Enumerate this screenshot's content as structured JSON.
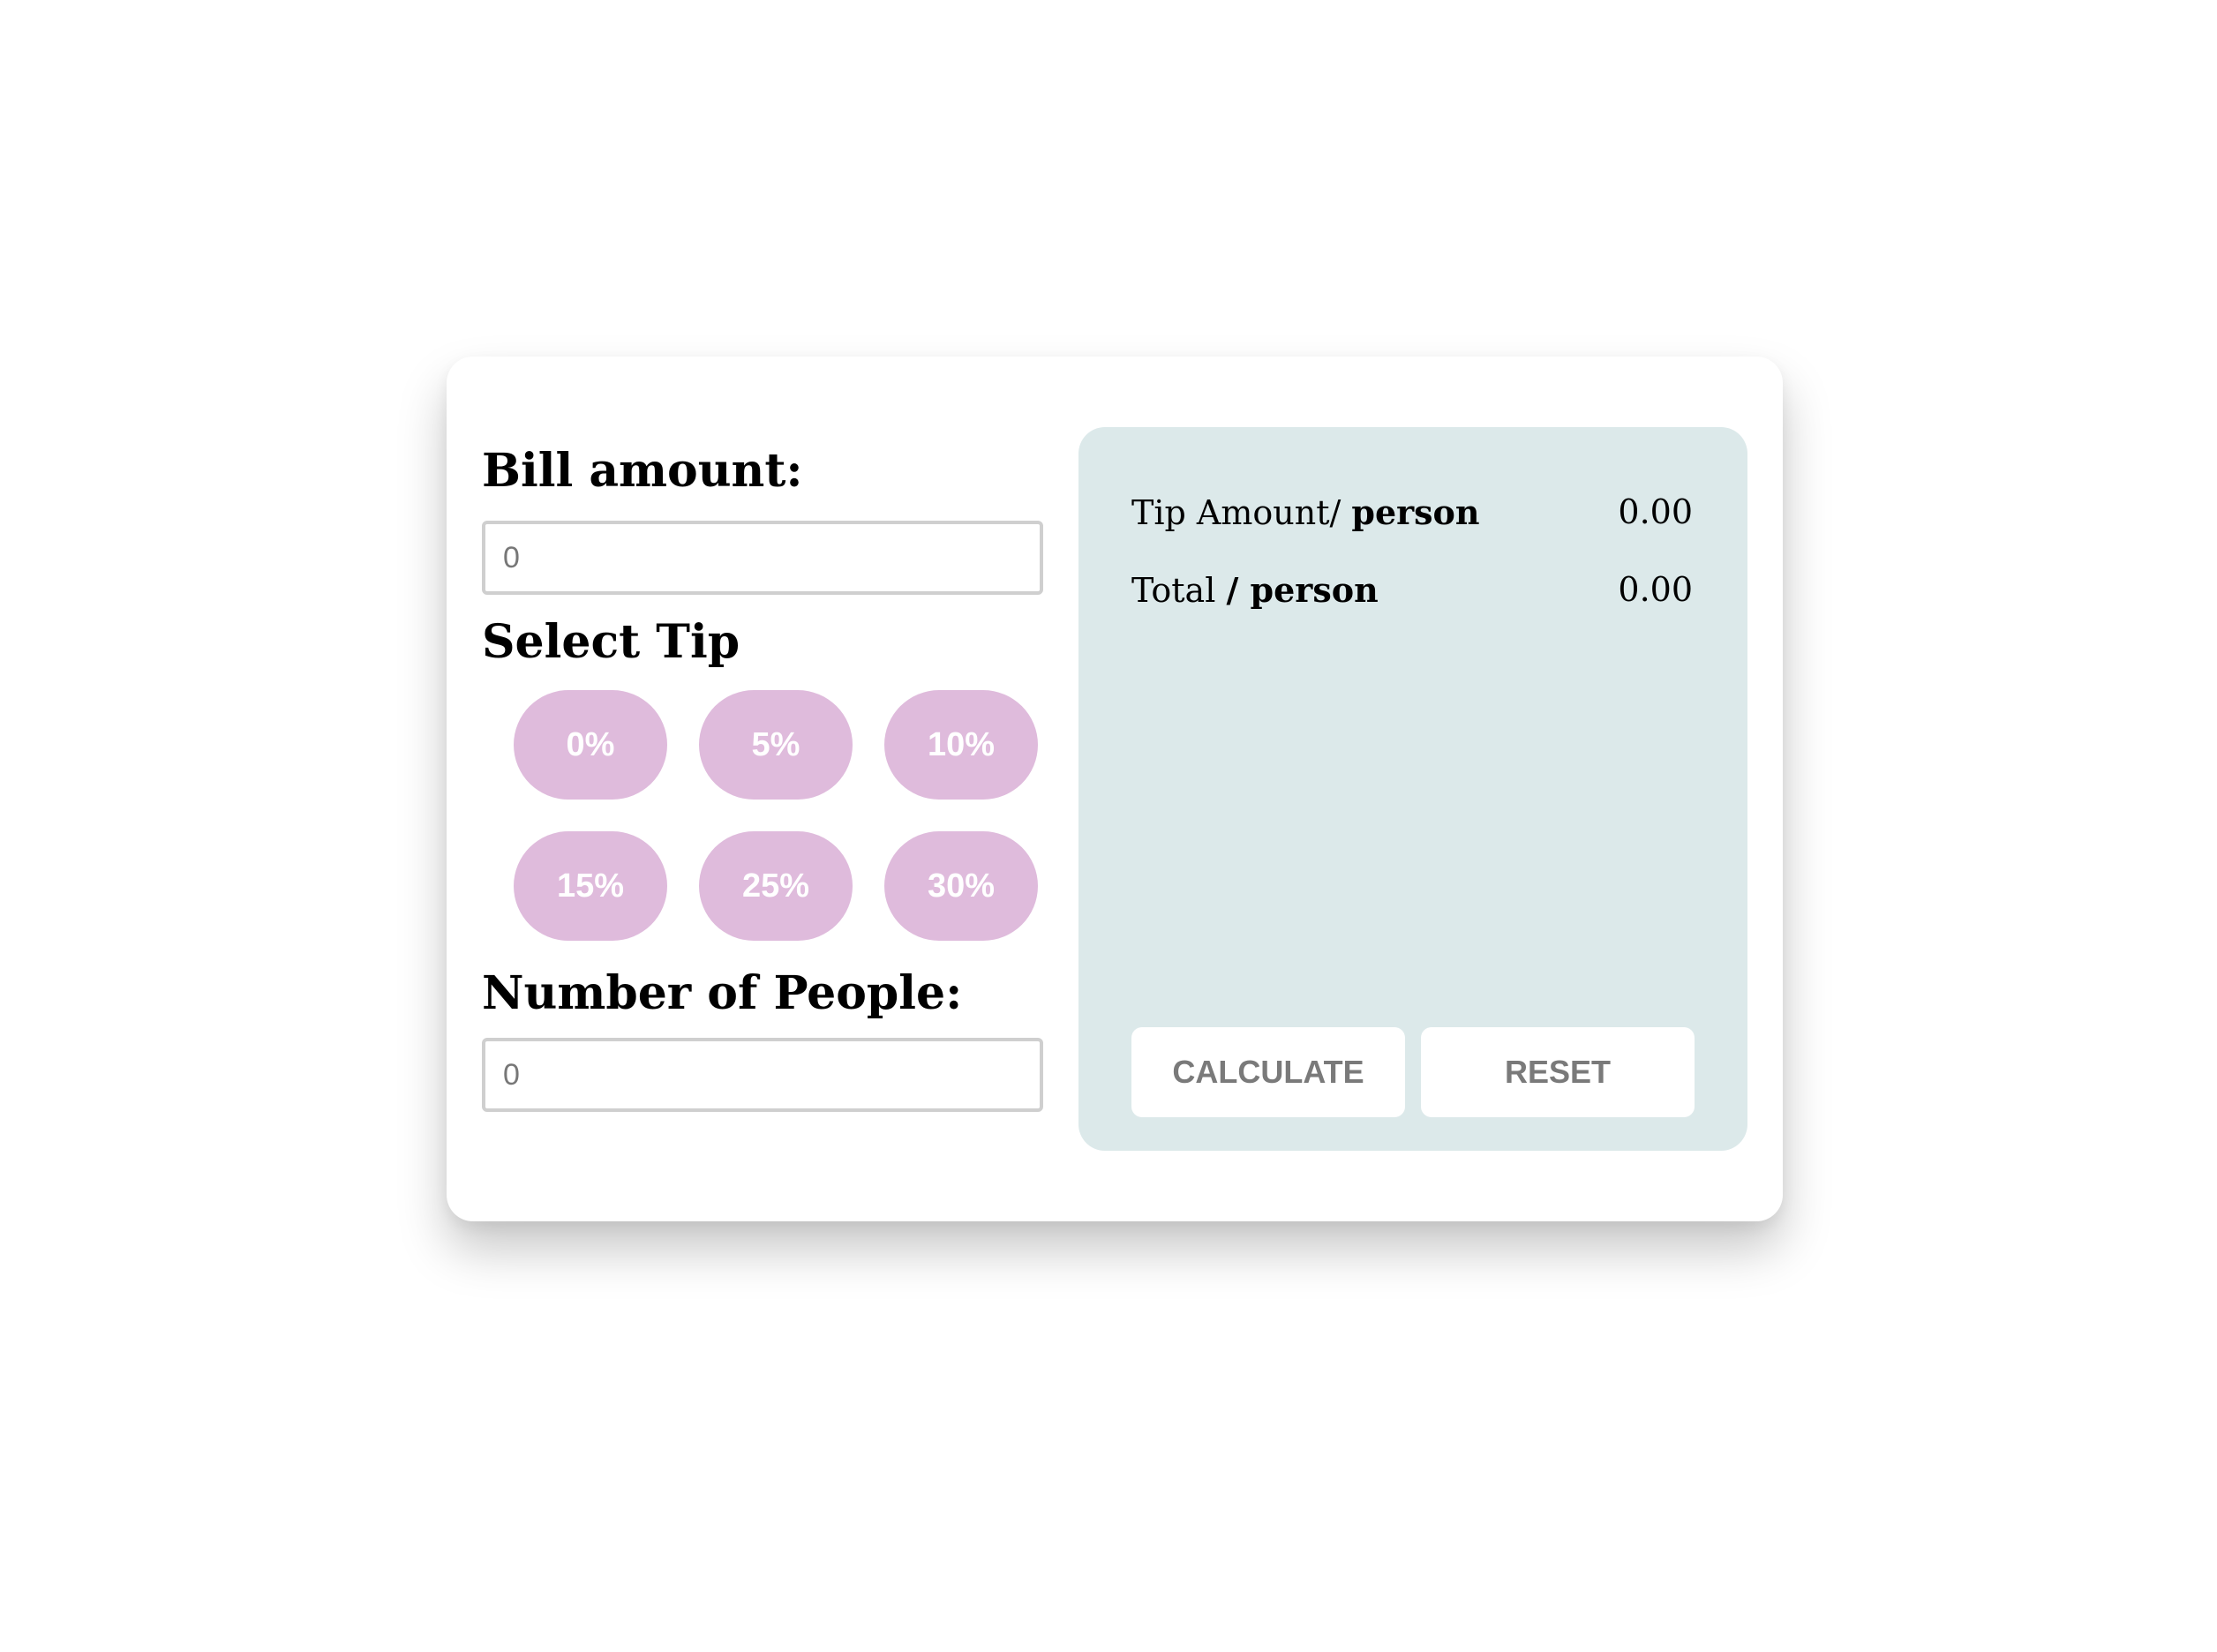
{
  "bill": {
    "heading": "Bill amount:",
    "placeholder": "0",
    "value": ""
  },
  "tip": {
    "heading": "Select Tip",
    "options": [
      "0%",
      "5%",
      "10%",
      "15%",
      "25%",
      "30%"
    ]
  },
  "people": {
    "heading": "Number of People:",
    "placeholder": "0",
    "value": ""
  },
  "results": {
    "tip_label_prefix": "Tip Amount/",
    "tip_label_bold": "person",
    "tip_value": "0.00",
    "total_label_prefix": "Total",
    "total_label_bold": "/ person",
    "total_value": "0.00"
  },
  "actions": {
    "calculate_label": "CALCULATE",
    "reset_label": "RESET"
  },
  "colors": {
    "tip_button": "#dfbbdc",
    "results_panel": "#dce9ea",
    "card": "#ffffff"
  }
}
